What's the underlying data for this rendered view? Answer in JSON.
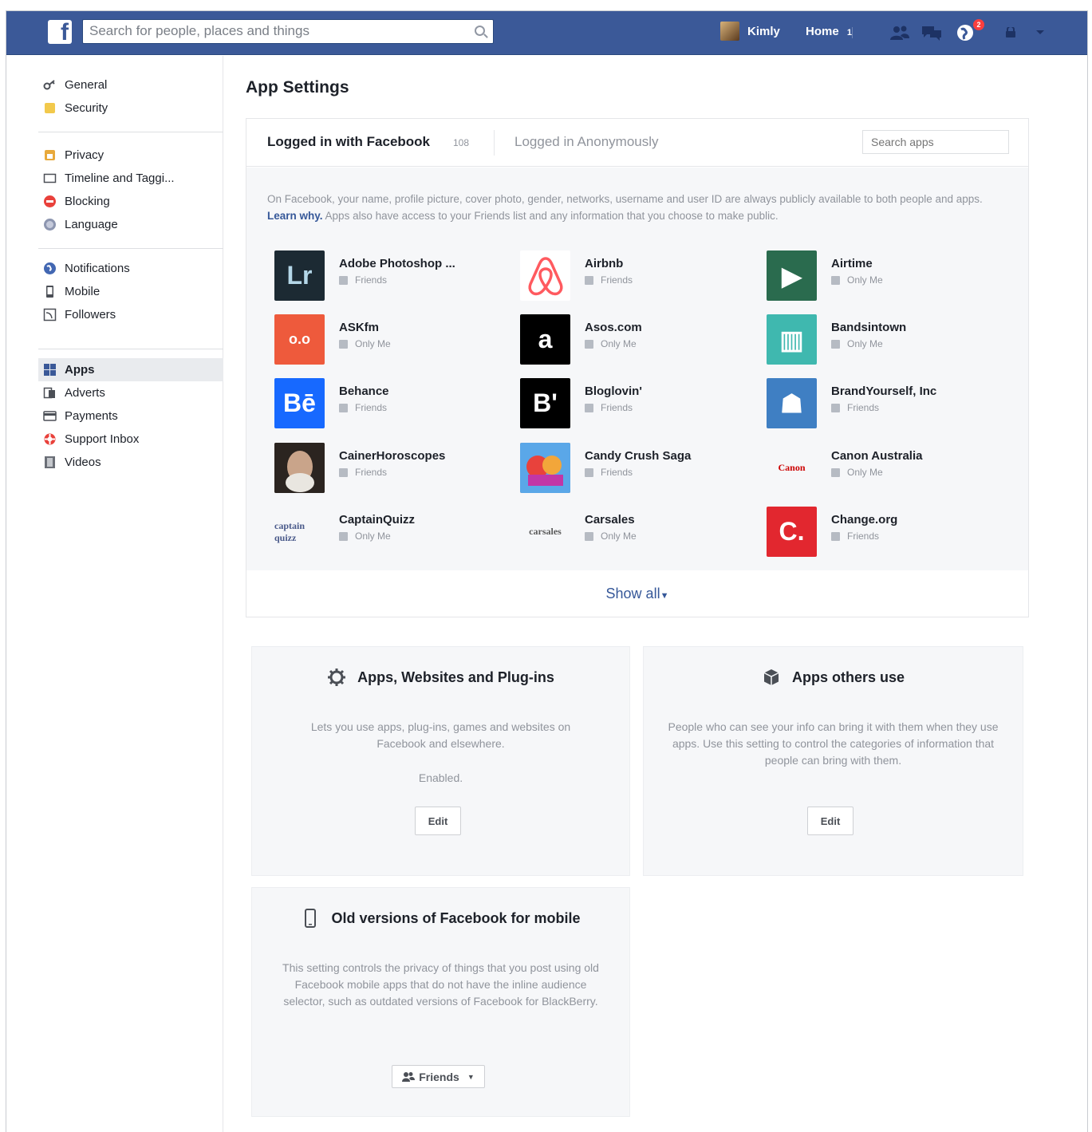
{
  "topbar": {
    "search_placeholder": "Search for people, places and things",
    "user_name": "Kimly",
    "home_label": "Home",
    "home_count": "1",
    "notification_count": "2",
    "brand_color": "#3b5998"
  },
  "sidebar": {
    "groups": [
      [
        {
          "label": "General",
          "icon": "key-icon"
        },
        {
          "label": "Security",
          "icon": "shield-icon"
        }
      ],
      [
        {
          "label": "Privacy",
          "icon": "lock-icon"
        },
        {
          "label": "Timeline and Taggi...",
          "icon": "timeline-icon"
        },
        {
          "label": "Blocking",
          "icon": "block-icon"
        },
        {
          "label": "Language",
          "icon": "globe-icon"
        }
      ],
      [
        {
          "label": "Notifications",
          "icon": "globe-notification-icon"
        },
        {
          "label": "Mobile",
          "icon": "mobile-icon"
        },
        {
          "label": "Followers",
          "icon": "rss-icon"
        }
      ],
      [
        {
          "label": "Apps",
          "icon": "apps-icon",
          "active": true
        },
        {
          "label": "Adverts",
          "icon": "adverts-icon"
        },
        {
          "label": "Payments",
          "icon": "card-icon"
        },
        {
          "label": "Support Inbox",
          "icon": "lifebuoy-icon"
        },
        {
          "label": "Videos",
          "icon": "film-icon"
        }
      ]
    ]
  },
  "main": {
    "title": "App Settings",
    "tabs": {
      "logged_in": "Logged in with Facebook",
      "logged_in_count": "108",
      "anonymous": "Logged in Anonymously",
      "search_placeholder": "Search apps"
    },
    "info_text_1": "On Facebook, your name, profile picture, cover photo, gender, networks, username and user ID are always publicly available to both people and apps.",
    "info_link": "Learn why.",
    "info_text_2": "Apps also have access to your Friends list and any information that you choose to make public.",
    "apps": [
      {
        "name": "Adobe Photoshop ...",
        "privacy": "Friends",
        "logo_text": "Lr",
        "logo_bg": "#1c2a33",
        "logo_fg": "#b4d7e8"
      },
      {
        "name": "Airbnb",
        "privacy": "Friends",
        "logo_text": "",
        "logo_bg": "#ffffff",
        "logo_fg": "#ff5a5f"
      },
      {
        "name": "Airtime",
        "privacy": "Only Me",
        "logo_text": "▶",
        "logo_bg": "#2a6b4e",
        "logo_fg": "#ffffff"
      },
      {
        "name": "ASKfm",
        "privacy": "Only Me",
        "logo_text": "o.o",
        "logo_bg": "#ee5a3c",
        "logo_fg": "#ffffff"
      },
      {
        "name": "Asos.com",
        "privacy": "Only Me",
        "logo_text": "a",
        "logo_bg": "#000000",
        "logo_fg": "#ffffff"
      },
      {
        "name": "Bandsintown",
        "privacy": "Only Me",
        "logo_text": "▥",
        "logo_bg": "#3fb8af",
        "logo_fg": "#ffffff"
      },
      {
        "name": "Behance",
        "privacy": "Friends",
        "logo_text": "Bē",
        "logo_bg": "#1769ff",
        "logo_fg": "#ffffff"
      },
      {
        "name": "Bloglovin'",
        "privacy": "Friends",
        "logo_text": "B'",
        "logo_bg": "#000000",
        "logo_fg": "#ffffff"
      },
      {
        "name": "BrandYourself, Inc",
        "privacy": "Friends",
        "logo_text": "☗",
        "logo_bg": "#3f7fc3",
        "logo_fg": "#ffffff"
      },
      {
        "name": "CainerHoroscopes",
        "privacy": "Friends",
        "logo_text": "",
        "logo_bg": "#4a3a32",
        "logo_fg": "#ffffff"
      },
      {
        "name": "Candy Crush Saga",
        "privacy": "Friends",
        "logo_text": "",
        "logo_bg": "#e8742c",
        "logo_fg": "#ffffff"
      },
      {
        "name": "Canon Australia",
        "privacy": "Only Me",
        "logo_text": "Canon",
        "logo_bg": "#f6f7f9",
        "logo_fg": "#cc0000"
      },
      {
        "name": "CaptainQuizz",
        "privacy": "Only Me",
        "logo_text": "captain quizz",
        "logo_bg": "#f6f7f9",
        "logo_fg": "#4a5a8a"
      },
      {
        "name": "Carsales",
        "privacy": "Only Me",
        "logo_text": "carsales",
        "logo_bg": "#f6f7f9",
        "logo_fg": "#5a5a5a"
      },
      {
        "name": "Change.org",
        "privacy": "Friends",
        "logo_text": "C.",
        "logo_bg": "#e2272f",
        "logo_fg": "#ffffff"
      }
    ],
    "show_all": "Show all",
    "cards": {
      "apps_websites": {
        "title": "Apps, Websites and Plug-ins",
        "desc": "Lets you use apps, plug-ins, games and websites on Facebook and elsewhere.",
        "status": "Enabled.",
        "button": "Edit"
      },
      "apps_others": {
        "title": "Apps others use",
        "desc": "People who can see your info can bring it with them when they use apps. Use this setting to control the categories of information that people can bring with them.",
        "button": "Edit"
      },
      "old_versions": {
        "title": "Old versions of Facebook for mobile",
        "desc": "This setting controls the privacy of things that you post using old Facebook mobile apps that do not have the inline audience selector, such as outdated versions of Facebook for BlackBerry.",
        "button": "Friends"
      }
    }
  }
}
